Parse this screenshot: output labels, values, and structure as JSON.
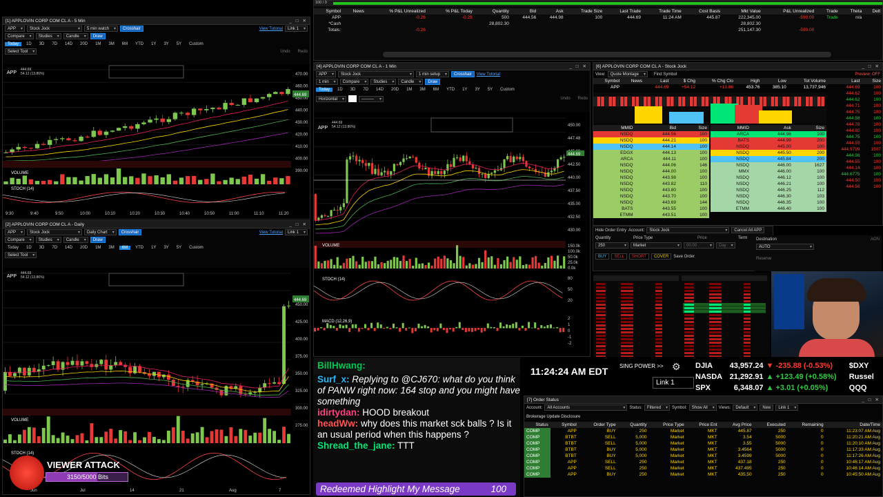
{
  "positions": {
    "columns": [
      "Symbol",
      "News",
      "% P&L Unrealized",
      "% P&L Today",
      "Quantity",
      "Bid",
      "Ask",
      "Trade Size",
      "Last Trade",
      "Trade Time",
      "Cost Basis",
      "Mkt Value",
      "P&L Unrealized",
      "Trade",
      "Theta",
      "Delt"
    ],
    "rows": [
      [
        "APP",
        "",
        "-0.26",
        "-0.26",
        "500",
        "444.56",
        "444.98",
        "100",
        "444.69",
        "11:24 AM",
        "445.87",
        "222,345.00",
        "-590.00",
        "Trade",
        "n/a"
      ],
      [
        "*Cash",
        "",
        "",
        "",
        "28,802.30",
        "",
        "",
        "",
        "",
        "",
        "",
        "28,802.30",
        "",
        "",
        ""
      ],
      [
        "Totals:",
        "",
        "-0.26",
        "",
        "",
        "",
        "",
        "",
        "",
        "",
        "",
        "251,147.30",
        "-590.00",
        "",
        ""
      ]
    ],
    "topbar": "100 / 0"
  },
  "w5min": {
    "title": "[1] APPLOVIN CORP COM CL A - 5 Min",
    "symbol": "APP",
    "acct": "Stock Jock",
    "setup": "5 min watch",
    "crosshair": "Crosshair",
    "draw": "Draw",
    "compare": "Compare",
    "studies": "Studies",
    "candle": "Candle",
    "tutorial": "View Tutorial",
    "link": "Link 1",
    "select_tool": "Select Tool",
    "undo": "Undo",
    "redo": "Redo",
    "last": "444.69",
    "chg": "54.12 (13.86%)",
    "ranges": [
      "Today",
      "1D",
      "3D",
      "7D",
      "14D",
      "20D",
      "1M",
      "3M",
      "6M",
      "YTD",
      "1Y",
      "3Y",
      "5Y",
      "Custom"
    ],
    "times": [
      "9:30",
      "9:40",
      "9:50",
      "10:00",
      "10:10",
      "10:20",
      "10:30",
      "10:40",
      "10:50",
      "11:00",
      "11:10",
      "11:20"
    ],
    "prices": [
      "470.00",
      "460.00",
      "450.00",
      "440.00",
      "430.00",
      "420.00",
      "410.00",
      "400.00",
      "390.00"
    ],
    "volume": "VOLUME",
    "stoch": "STOCH (14)"
  },
  "wdaily": {
    "title": "[2] APPLOVIN CORP COM CL A - Daily",
    "symbol": "APP",
    "acct": "Stock Jock",
    "setup": "Daily Chart",
    "crosshair": "Crosshair",
    "draw": "Draw",
    "tutorial": "View Tutorial",
    "link": "Link 1",
    "select_tool": "Select Tool",
    "last": "444.69",
    "chg": "54.12 (13.86%)",
    "ranges": [
      "Today",
      "1D",
      "3D",
      "7D",
      "14D",
      "20D",
      "1M",
      "3M",
      "6M",
      "YTD",
      "1Y",
      "3Y",
      "5Y",
      "Custom"
    ],
    "prices": [
      "450.00",
      "425.00",
      "400.00",
      "375.00",
      "350.00",
      "325.00",
      "300.00",
      "275.00"
    ],
    "months": [
      "Jun",
      "Jul",
      "14",
      "21",
      "Aug",
      "7"
    ],
    "volume": "VOLUME",
    "stoch": "STOCH (14)"
  },
  "w1min": {
    "title": "[4] APPLOVIN CORP COM CL A - 1 Min",
    "symbol": "APP",
    "acct": "Stock Jock",
    "setup": "1 min setup",
    "crosshair": "Crosshair",
    "tutorial": "View Tutorial",
    "link": "Link 1",
    "horizontal": "Horizontal",
    "last": "444.69",
    "chg": "54.12 (13.86%)",
    "ranges": [
      "Today",
      "1D",
      "3D",
      "7D",
      "14D",
      "20D",
      "1M",
      "3M",
      "6M",
      "YTD",
      "1Y",
      "3Y",
      "5Y",
      "Custom"
    ],
    "prices": [
      "450.00",
      "447.48",
      "445.00",
      "442.50",
      "440.00",
      "437.50",
      "435.00",
      "432.50",
      "430.00"
    ],
    "volume": "VOLUME",
    "stoch": "STOCH (14)",
    "macd": "MACD (12,26,9)",
    "volaxis": [
      "150.0k",
      "100.0k",
      "50.0k",
      "25.0k",
      "0.0k"
    ],
    "stochaxis": [
      "80",
      "50",
      "20"
    ],
    "macdaxis": [
      "2",
      "1",
      "0",
      "-1",
      "-2"
    ]
  },
  "l2": {
    "title": "[6] APPLOVIN CORP COM CL A - Stock Jock",
    "view": "Quote Montage",
    "find": "Find Symbol",
    "preview": "Preview: OFF",
    "quote_cols": [
      "Symbol",
      "News",
      "Last",
      "$ Chg",
      "% Chg Clo",
      "High",
      "Low",
      "Tot Volume"
    ],
    "quote": [
      "APP",
      "",
      "444.69",
      "+54.12",
      "+13.86",
      "453.76",
      "385.10",
      "13,737,946"
    ],
    "bid_cols": [
      "MMID",
      "Bid",
      "Size"
    ],
    "ask_cols": [
      "MMID",
      "Ask",
      "Size"
    ],
    "bids": [
      [
        "NSDQ",
        "444.56",
        "100"
      ],
      [
        "NSDQ",
        "444.21",
        "100"
      ],
      [
        "NSDQ",
        "444.14",
        "100"
      ],
      [
        "EDGX",
        "444.13",
        "100"
      ],
      [
        "ARCA",
        "444.11",
        "100"
      ],
      [
        "NSDQ",
        "444.06",
        "146"
      ],
      [
        "NSDQ",
        "444.00",
        "100"
      ],
      [
        "NSDQ",
        "443.98",
        "100"
      ],
      [
        "NSDQ",
        "443.82",
        "110"
      ],
      [
        "NSDQ",
        "443.80",
        "100"
      ],
      [
        "NSDQ",
        "443.70",
        "100"
      ],
      [
        "NSDQ",
        "443.69",
        "144"
      ],
      [
        "BATS",
        "443.55",
        "100"
      ],
      [
        "ETMM",
        "443.51",
        "100"
      ]
    ],
    "asks": [
      [
        "ARCA",
        "444.98",
        "100"
      ],
      [
        "BATS",
        "444.99",
        "200"
      ],
      [
        "NSDQ",
        "445.00",
        "100"
      ],
      [
        "NSDQ",
        "445.50",
        "200"
      ],
      [
        "NSDQ",
        "445.84",
        "200"
      ],
      [
        "NSDQ",
        "446.00",
        "1627"
      ],
      [
        "MMX",
        "446.00",
        "100"
      ],
      [
        "NSDQ",
        "446.12",
        "100"
      ],
      [
        "NSDQ",
        "446.21",
        "100"
      ],
      [
        "NSDQ",
        "446.25",
        "112"
      ],
      [
        "NSDQ",
        "446.30",
        "103"
      ],
      [
        "NSDQ",
        "446.35",
        "100"
      ],
      [
        "ETMM",
        "446.40",
        "100"
      ]
    ],
    "ts_cols": [
      "Last",
      "Size"
    ],
    "ts": [
      [
        "444.69",
        "100"
      ],
      [
        "444.62",
        "100"
      ],
      [
        "444.62",
        "100"
      ],
      [
        "444.71",
        "100"
      ],
      [
        "444.75",
        "100"
      ],
      [
        "444.58",
        "100"
      ],
      [
        "444.78",
        "100"
      ],
      [
        "444.80",
        "100"
      ],
      [
        "444.75",
        "100"
      ],
      [
        "444.55",
        "100"
      ],
      [
        "444.9799",
        "1507"
      ],
      [
        "444.98",
        "100"
      ],
      [
        "444.55",
        "100"
      ],
      [
        "444.14",
        "100"
      ],
      [
        "444.6775",
        "100"
      ],
      [
        "444.50",
        "100"
      ],
      [
        "444.56",
        "100"
      ]
    ]
  },
  "order": {
    "hide": "Hide Order Entry",
    "account_label": "Account:",
    "account": "Stock Jock",
    "cancel_all": "Cancel All APP",
    "qty_label": "Quantity",
    "qty": "250",
    "type_label": "Price Type",
    "type": "Market",
    "price_label": "Price",
    "price": "00.00",
    "term_label": "Term",
    "term": "Day",
    "dest_label": "Destination",
    "dest": "AUTO",
    "aon": "AON",
    "buy": "BUY",
    "sell": "SELL",
    "short": "SHORT",
    "cover": "COVER",
    "save": "Save Order",
    "reserve": "Reserve"
  },
  "stream": {
    "time": "11:24:24 AM EDT",
    "bp": "SING POWER >>",
    "link": "Link 1",
    "indices": [
      [
        "DJIA",
        "43,957.24",
        "-235.88 (-0.53%)",
        "$DXY"
      ],
      [
        "NASDAQ",
        "21,292.91",
        "+123.49 (+0.58%)",
        "Russel"
      ],
      [
        "SPX",
        "6,348.07",
        "+3.01 (+0.05%)",
        "QQQ"
      ]
    ],
    "chat": [
      {
        "user": "BillHwang:",
        "msg": ""
      },
      {
        "user": "Surf_x:",
        "msg": "Replying to @CJ670: what do you think of PANW right now: 164 stop and you might have something"
      },
      {
        "user": "idirtydan:",
        "msg": "HOOD breakout"
      },
      {
        "user": "headWw:",
        "msg": "why does this market sck balls ? Is it an usual period when this happens ?"
      },
      {
        "user": "Shread_the_jane:",
        "msg": "TTT"
      }
    ],
    "redeem": "Redeemed Highlight My Message",
    "redeem_pts": "100",
    "attack": "VIEWER ATTACK",
    "bits": "3150/5000 Bits"
  },
  "orders": {
    "title": "[7] Order Status",
    "account_label": "Account:",
    "account": "All Accounts",
    "status_label": "Status:",
    "status": "Filtered",
    "symbol_label": "Symbol:",
    "symbol": "Show All",
    "views_label": "Views:",
    "views": "Default",
    "new": "New",
    "link": "Link 1",
    "disclosure": "Brokerage Update Disclosure",
    "columns": [
      "Status",
      "Symbol",
      "Order Type",
      "Quantity",
      "Price Type",
      "Price Ent",
      "Avg Price",
      "Executed",
      "Remaining",
      "Date/Time"
    ],
    "rows": [
      [
        "COMP",
        "APP",
        "BUY",
        "250",
        "Market",
        "MKT",
        "445.87",
        "250",
        "0",
        "11:23:07 AM Aug"
      ],
      [
        "COMP",
        "BTBT",
        "SELL",
        "5,000",
        "Market",
        "MKT",
        "3.54",
        "5000",
        "0",
        "11:20:21 AM Aug"
      ],
      [
        "COMP",
        "BTBT",
        "SELL",
        "5,000",
        "Market",
        "MKT",
        "3.55",
        "5000",
        "0",
        "11:20:10 AM Aug"
      ],
      [
        "COMP",
        "BTBT",
        "BUY",
        "5,000",
        "Market",
        "MKT",
        "3.4564",
        "5000",
        "0",
        "11:17:33 AM Aug"
      ],
      [
        "COMP",
        "BTBT",
        "BUY",
        "5,000",
        "Market",
        "MKT",
        "3.4599",
        "5000",
        "0",
        "11:17:26 AM Aug"
      ],
      [
        "COMP",
        "APP",
        "SELL",
        "250",
        "Market",
        "MKT",
        "437.18",
        "250",
        "0",
        "10:46:17 AM Aug"
      ],
      [
        "COMP",
        "APP",
        "SELL",
        "250",
        "Market",
        "MKT",
        "437.495",
        "250",
        "0",
        "10:46:14 AM Aug"
      ],
      [
        "COMP",
        "APP",
        "BUY",
        "250",
        "Market",
        "MKT",
        "435.50",
        "250",
        "0",
        "10:45:50 AM Aug"
      ]
    ]
  },
  "colors": {
    "up": "#7ec850",
    "down": "#e53935",
    "accent": "#1e88e5"
  }
}
